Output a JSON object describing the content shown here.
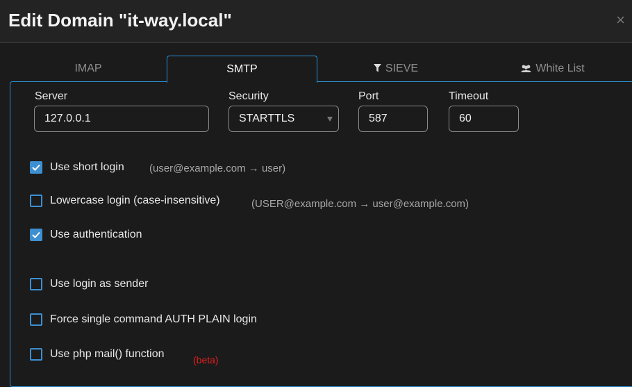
{
  "dialog": {
    "title": "Edit Domain \"it-way.local\"",
    "close_glyph": "×"
  },
  "tabs": [
    {
      "label": "IMAP",
      "icon": "",
      "active": false
    },
    {
      "label": "SMTP",
      "icon": "",
      "active": true
    },
    {
      "label": "SIEVE",
      "icon": "filter-icon",
      "active": false
    },
    {
      "label": "White List",
      "icon": "users-icon",
      "active": false
    }
  ],
  "form": {
    "server": {
      "label": "Server",
      "value": "127.0.0.1"
    },
    "security": {
      "label": "Security",
      "value": "STARTTLS"
    },
    "port": {
      "label": "Port",
      "value": "587"
    },
    "timeout": {
      "label": "Timeout",
      "value": "60"
    }
  },
  "options": [
    {
      "label": "Use short login",
      "checked": true,
      "hint": "(user@example.com → user)"
    },
    {
      "label": "Lowercase login (case-insensitive)",
      "checked": false,
      "hint": "(USER@example.com → user@example.com)"
    },
    {
      "label": "Use authentication",
      "checked": true,
      "hint": ""
    },
    {
      "label": "Use login as sender",
      "checked": false,
      "hint": ""
    },
    {
      "label": "Force single command AUTH PLAIN login",
      "checked": false,
      "hint": ""
    },
    {
      "label": "Use php mail() function",
      "checked": false,
      "hint": "(beta)"
    }
  ],
  "colors": {
    "accent": "#2b8fd6",
    "checkbox": "#3d8fd1",
    "beta": "#e02020",
    "background": "#1b1b1b"
  }
}
